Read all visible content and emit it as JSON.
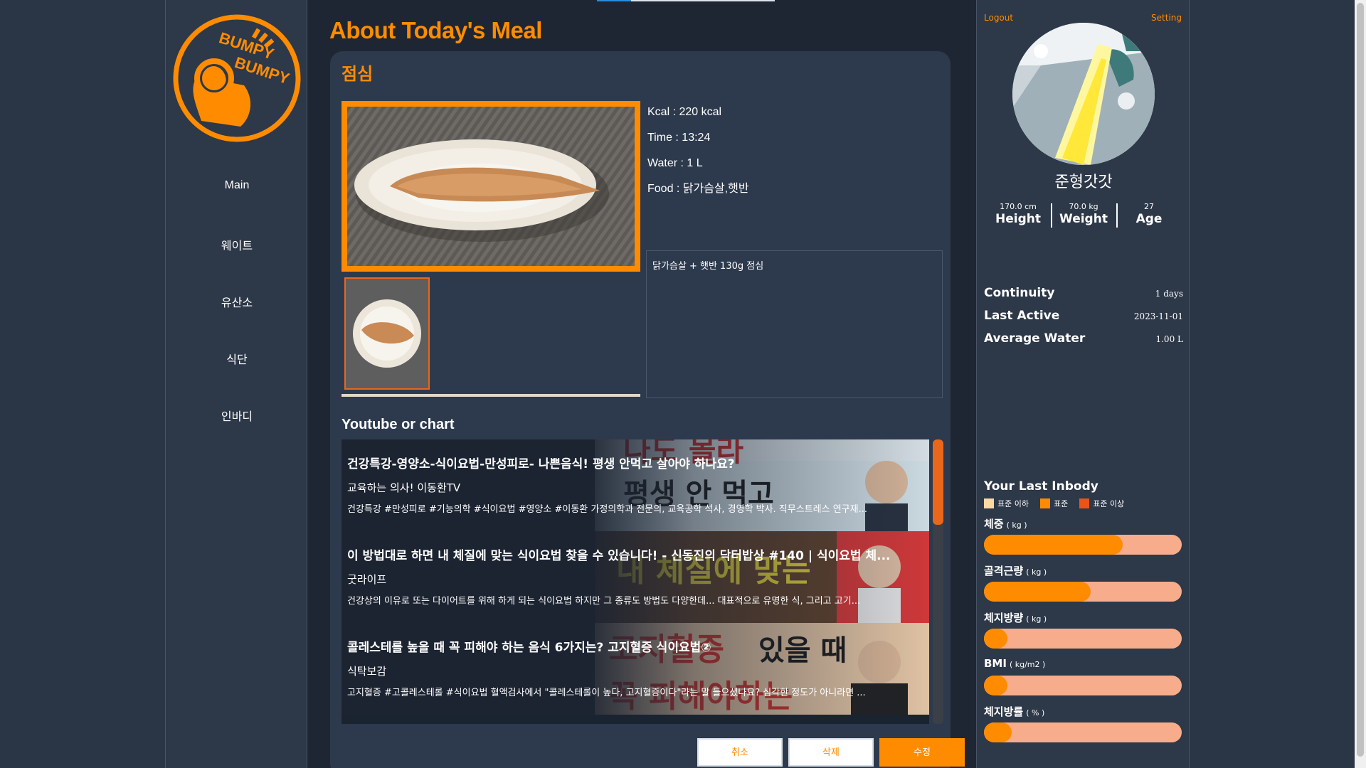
{
  "left_sidebar": {
    "logo_text": [
      "BUMPY",
      "BUMPY"
    ],
    "nav": [
      {
        "label": "Main"
      },
      {
        "label": "웨이트"
      },
      {
        "label": "유산소"
      },
      {
        "label": "식단"
      },
      {
        "label": "인바디"
      }
    ]
  },
  "main": {
    "page_title": "About Today's Meal",
    "card_title": "점심",
    "info": {
      "kcal": "Kcal : 220 kcal",
      "time": "Time : 13:24",
      "water": "Water : 1 L",
      "food": "Food : 닭가슴살,햇반"
    },
    "memo": "닭가슴살 + 햇반 130g 점심",
    "youtube_header": "Youtube or chart",
    "videos": [
      {
        "title": "건강특강-영양소-식이요법-만성피로- 나쁜음식! 평생 안먹고 살아야 하나요?",
        "channel": "교육하는 의사! 이동환TV",
        "desc": "건강특강 #만성피로 #기능의학 #식이요법 #영양소 #이동환 가정의학과 전문의, 교육공학 석사, 경영학 박사. 직무스트레스 연구재..."
      },
      {
        "title": "이 방법대로 하면 내 체질에 맞는 식이요법 찾을 수 있습니다! - 신동진의 닥터밥상 #140 | 식이요법 체...",
        "channel": "굿라이프",
        "desc": "건강상의 이유로 또는 다이어트를 위해 하게 되는 식이요법 하지만 그 종류도 방법도 다양한데... 대표적으로 유명한 식, 그리고 고기..."
      },
      {
        "title": "콜레스테롤 높을 때 꼭 피해야 하는 음식 6가지는? 고지혈증 식이요법②",
        "channel": "식탁보감",
        "desc": "고지혈증 #고콜레스테롤 #식이요법 혈액검사에서 \"콜레스테롤이 높다, 고지혈증이다\"라는 말 들으셨나요? 심각한 정도가 아니라면 ..."
      }
    ],
    "buttons": {
      "cancel": "취소",
      "delete": "삭제",
      "edit": "수정"
    }
  },
  "right_sidebar": {
    "logout": "Logout",
    "setting": "Setting",
    "username": "준형갓갓",
    "stats": [
      {
        "value": "170.0 cm",
        "label": "Height"
      },
      {
        "value": "70.0 kg",
        "label": "Weight"
      },
      {
        "value": "27",
        "label": "Age"
      }
    ],
    "meta": [
      {
        "label": "Continuity",
        "value": "1 days"
      },
      {
        "label": "Last Active",
        "value": "2023-11-01"
      },
      {
        "label": "Average Water",
        "value": "1.00 L"
      }
    ],
    "inbody_title": "Your Last Inbody",
    "legend": [
      {
        "label": "표준 이하",
        "color": "#fbd9a5"
      },
      {
        "label": "표준",
        "color": "#ff8c00"
      },
      {
        "label": "표준 이상",
        "color": "#e9541a"
      }
    ],
    "metrics": [
      {
        "label": "체중",
        "unit": "( kg )",
        "level": 0.7
      },
      {
        "label": "골격근량",
        "unit": "( kg )",
        "level": 0.54
      },
      {
        "label": "체지방량",
        "unit": "( kg )",
        "level": 0.12
      },
      {
        "label": "BMI",
        "unit": "( kg/m2 )",
        "level": 0.12
      },
      {
        "label": "체지방률",
        "unit": "( % )",
        "level": 0.14
      }
    ]
  },
  "colors": {
    "accent": "#ff8c00",
    "bg": "#1e2634",
    "panel": "#2d3848",
    "bar_track": "#f7ad8c"
  }
}
